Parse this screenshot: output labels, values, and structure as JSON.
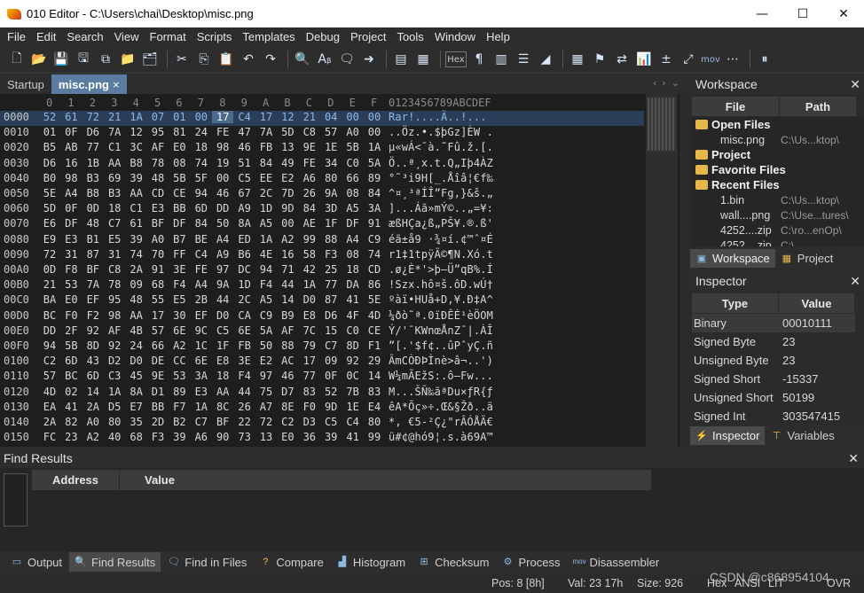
{
  "window": {
    "title": "010 Editor - C:\\Users\\chai\\Desktop\\misc.png",
    "minimize": "—",
    "maximize": "☐",
    "close": "✕"
  },
  "menu": [
    "File",
    "Edit",
    "Search",
    "View",
    "Format",
    "Scripts",
    "Templates",
    "Debug",
    "Project",
    "Tools",
    "Window",
    "Help"
  ],
  "toolbar": {
    "hex_label": "Hex",
    "mov_label": "mov"
  },
  "tabs": [
    {
      "label": "Startup",
      "active": false
    },
    {
      "label": "misc.png",
      "active": true,
      "close": "×"
    }
  ],
  "hex": {
    "columns": [
      "0",
      "1",
      "2",
      "3",
      "4",
      "5",
      "6",
      "7",
      "8",
      "9",
      "A",
      "B",
      "C",
      "D",
      "E",
      "F"
    ],
    "ascii_header": "0123456789ABCDEF",
    "rows": [
      {
        "addr": "0000",
        "bytes": [
          "52",
          "61",
          "72",
          "21",
          "1A",
          "07",
          "01",
          "00",
          "17",
          "C4",
          "17",
          "12",
          "21",
          "04",
          "00",
          "00"
        ],
        "ascii": "Rar!....Ä..!..."
      },
      {
        "addr": "0010",
        "bytes": [
          "01",
          "0F",
          "D6",
          "7A",
          "12",
          "95",
          "81",
          "24",
          "FE",
          "47",
          "7A",
          "5D",
          "C8",
          "57",
          "A0",
          "00"
        ],
        "ascii": "..Öz.•.$þGz]ÈW ."
      },
      {
        "addr": "0020",
        "bytes": [
          "B5",
          "AB",
          "77",
          "C1",
          "3C",
          "AF",
          "E0",
          "18",
          "98",
          "46",
          "FB",
          "13",
          "9E",
          "1E",
          "5B",
          "1A"
        ],
        "ascii": "µ«wÁ<¯à.˜Fû.ž.[."
      },
      {
        "addr": "0030",
        "bytes": [
          "D6",
          "16",
          "1B",
          "AA",
          "B8",
          "78",
          "08",
          "74",
          "19",
          "51",
          "84",
          "49",
          "FE",
          "34",
          "C0",
          "5A"
        ],
        "ascii": "Ö..ª¸x.t.Q„Iþ4ÀZ"
      },
      {
        "addr": "0040",
        "bytes": [
          "B0",
          "98",
          "B3",
          "69",
          "39",
          "48",
          "5B",
          "5F",
          "00",
          "C5",
          "EE",
          "E2",
          "A6",
          "80",
          "66",
          "89"
        ],
        "ascii": "°˜³i9H[_.Åîâ¦€f‰"
      },
      {
        "addr": "0050",
        "bytes": [
          "5E",
          "A4",
          "B8",
          "B3",
          "AA",
          "CD",
          "CE",
          "94",
          "46",
          "67",
          "2C",
          "7D",
          "26",
          "9A",
          "08",
          "84"
        ],
        "ascii": "^¤¸³ªÍÎ”Fg,}&š.„"
      },
      {
        "addr": "0060",
        "bytes": [
          "5D",
          "0F",
          "0D",
          "18",
          "C1",
          "E3",
          "BB",
          "6D",
          "DD",
          "A9",
          "1D",
          "9D",
          "84",
          "3D",
          "A5",
          "3A"
        ],
        "ascii": "]...Áã»mÝ©..„=¥:"
      },
      {
        "addr": "0070",
        "bytes": [
          "E6",
          "DF",
          "48",
          "C7",
          "61",
          "BF",
          "DF",
          "84",
          "50",
          "8A",
          "A5",
          "00",
          "AE",
          "1F",
          "DF",
          "91"
        ],
        "ascii": "æßHÇa¿ß„PŠ¥.®.ß'"
      },
      {
        "addr": "0080",
        "bytes": [
          "E9",
          "E3",
          "B1",
          "E5",
          "39",
          "A0",
          "B7",
          "BE",
          "A4",
          "ED",
          "1A",
          "A2",
          "99",
          "88",
          "A4",
          "C9"
        ],
        "ascii": "éã±å9 ·¾¤í.¢™ˆ¤É"
      },
      {
        "addr": "0090",
        "bytes": [
          "72",
          "31",
          "87",
          "31",
          "74",
          "70",
          "FF",
          "C4",
          "A9",
          "B6",
          "4E",
          "16",
          "58",
          "F3",
          "08",
          "74"
        ],
        "ascii": "r1‡1tpÿÄ©¶N.Xó.t"
      },
      {
        "addr": "00A0",
        "bytes": [
          "0D",
          "F8",
          "BF",
          "C8",
          "2A",
          "91",
          "3E",
          "FE",
          "97",
          "DC",
          "94",
          "71",
          "42",
          "25",
          "18",
          "CD"
        ],
        "ascii": ".ø¿È*'>þ—Ü”qB%.Í"
      },
      {
        "addr": "00B0",
        "bytes": [
          "21",
          "53",
          "7A",
          "78",
          "09",
          "68",
          "F4",
          "A4",
          "9A",
          "1D",
          "F4",
          "44",
          "1A",
          "77",
          "DA",
          "86"
        ],
        "ascii": "!Szx.hô¤š.ôD.wÚ†"
      },
      {
        "addr": "00C0",
        "bytes": [
          "BA",
          "E0",
          "EF",
          "95",
          "48",
          "55",
          "E5",
          "2B",
          "44",
          "2C",
          "A5",
          "14",
          "D0",
          "87",
          "41",
          "5E"
        ],
        "ascii": "ºàï•HUå+D,¥.Ð‡A^"
      },
      {
        "addr": "00D0",
        "bytes": [
          "BC",
          "F0",
          "F2",
          "98",
          "AA",
          "17",
          "30",
          "EF",
          "D0",
          "CA",
          "C9",
          "B9",
          "E8",
          "D6",
          "4F",
          "4D"
        ],
        "ascii": "¼ðò˜ª.0ïÐÊÉ¹èÖOM"
      },
      {
        "addr": "00E0",
        "bytes": [
          "DD",
          "2F",
          "92",
          "AF",
          "4B",
          "57",
          "6E",
          "9C",
          "C5",
          "6E",
          "5A",
          "AF",
          "7C",
          "15",
          "C0",
          "CE"
        ],
        "ascii": "Ý/'¯KWnœÅnZ¯|.ÀÎ"
      },
      {
        "addr": "00F0",
        "bytes": [
          "94",
          "5B",
          "8D",
          "92",
          "24",
          "66",
          "A2",
          "1C",
          "1F",
          "FB",
          "50",
          "88",
          "79",
          "C7",
          "8D",
          "F1"
        ],
        "ascii": "”[.'$f¢..ûPˆyÇ.ñ"
      },
      {
        "addr": "0100",
        "bytes": [
          "C2",
          "6D",
          "43",
          "D2",
          "D0",
          "DE",
          "CC",
          "6E",
          "E8",
          "3E",
          "E2",
          "AC",
          "17",
          "09",
          "92",
          "29"
        ],
        "ascii": "ÂmCÒÐÞÌnè>â¬..')"
      },
      {
        "addr": "0110",
        "bytes": [
          "57",
          "BC",
          "6D",
          "C3",
          "45",
          "9E",
          "53",
          "3A",
          "18",
          "F4",
          "97",
          "46",
          "77",
          "0F",
          "0C",
          "14"
        ],
        "ascii": "W¼mÃEžS:.ô—Fw..."
      },
      {
        "addr": "0120",
        "bytes": [
          "4D",
          "02",
          "14",
          "1A",
          "8A",
          "D1",
          "89",
          "E3",
          "AA",
          "44",
          "75",
          "D7",
          "83",
          "52",
          "7B",
          "83"
        ],
        "ascii": "M...ŠÑ‰ãªDu×ƒR{ƒ"
      },
      {
        "addr": "0130",
        "bytes": [
          "EA",
          "41",
          "2A",
          "D5",
          "E7",
          "BB",
          "F7",
          "1A",
          "8C",
          "26",
          "A7",
          "8E",
          "F0",
          "9D",
          "1E",
          "E4"
        ],
        "ascii": "êA*Õç»÷.Œ&§Žð..ä"
      },
      {
        "addr": "0140",
        "bytes": [
          "2A",
          "82",
          "A0",
          "80",
          "35",
          "2D",
          "B2",
          "C7",
          "BF",
          "22",
          "72",
          "C2",
          "D3",
          "C5",
          "C4",
          "80"
        ],
        "ascii": "*‚ €5-²Ç¿\"rÂÓÅÄ€"
      },
      {
        "addr": "0150",
        "bytes": [
          "FC",
          "23",
          "A2",
          "40",
          "68",
          "F3",
          "39",
          "A6",
          "90",
          "73",
          "13",
          "E0",
          "36",
          "39",
          "41",
          "99"
        ],
        "ascii": "ü#¢@hó9¦.s.à69A™"
      }
    ]
  },
  "workspace": {
    "title": "Workspace",
    "close": "✕",
    "col_file": "File",
    "col_path": "Path",
    "open_files": "Open Files",
    "open_list": [
      {
        "name": "misc.png",
        "path": "C:\\Us...ktop\\"
      }
    ],
    "project": "Project",
    "favorite_files": "Favorite Files",
    "recent_files": "Recent Files",
    "recent_list": [
      {
        "name": "1.bin",
        "path": "C:\\Us...ktop\\"
      },
      {
        "name": "wall....png",
        "path": "C:\\Use...tures\\"
      },
      {
        "name": "4252....zip",
        "path": "C:\\ro...enOp\\"
      },
      {
        "name": "4252....zip",
        "path": "C:\\..."
      }
    ],
    "tab_workspace": "Workspace",
    "tab_project": "Project"
  },
  "inspector": {
    "title": "Inspector",
    "close": "✕",
    "col_type": "Type",
    "col_value": "Value",
    "rows": [
      {
        "type": "Binary",
        "value": "00010111"
      },
      {
        "type": "Signed Byte",
        "value": "23"
      },
      {
        "type": "Unsigned Byte",
        "value": "23"
      },
      {
        "type": "Signed Short",
        "value": "-15337"
      },
      {
        "type": "Unsigned Short",
        "value": "50199"
      },
      {
        "type": "Signed Int",
        "value": "303547415"
      }
    ],
    "tab_inspector": "Inspector",
    "tab_variables": "Variables"
  },
  "find_results": {
    "title": "Find Results",
    "close": "✕",
    "col_address": "Address",
    "col_value": "Value"
  },
  "bottom_tabs": [
    "Output",
    "Find Results",
    "Find in Files",
    "Compare",
    "Histogram",
    "Checksum",
    "Process",
    "Disassembler"
  ],
  "status": {
    "pos": "Pos: 8 [8h]",
    "val": "Val: 23 17h",
    "size": "Size: 926",
    "hex": "Hex",
    "ansi": "ANSI",
    "lit": "LIT",
    "ovr": "OVR"
  },
  "watermark": "CSDN @c868954104"
}
